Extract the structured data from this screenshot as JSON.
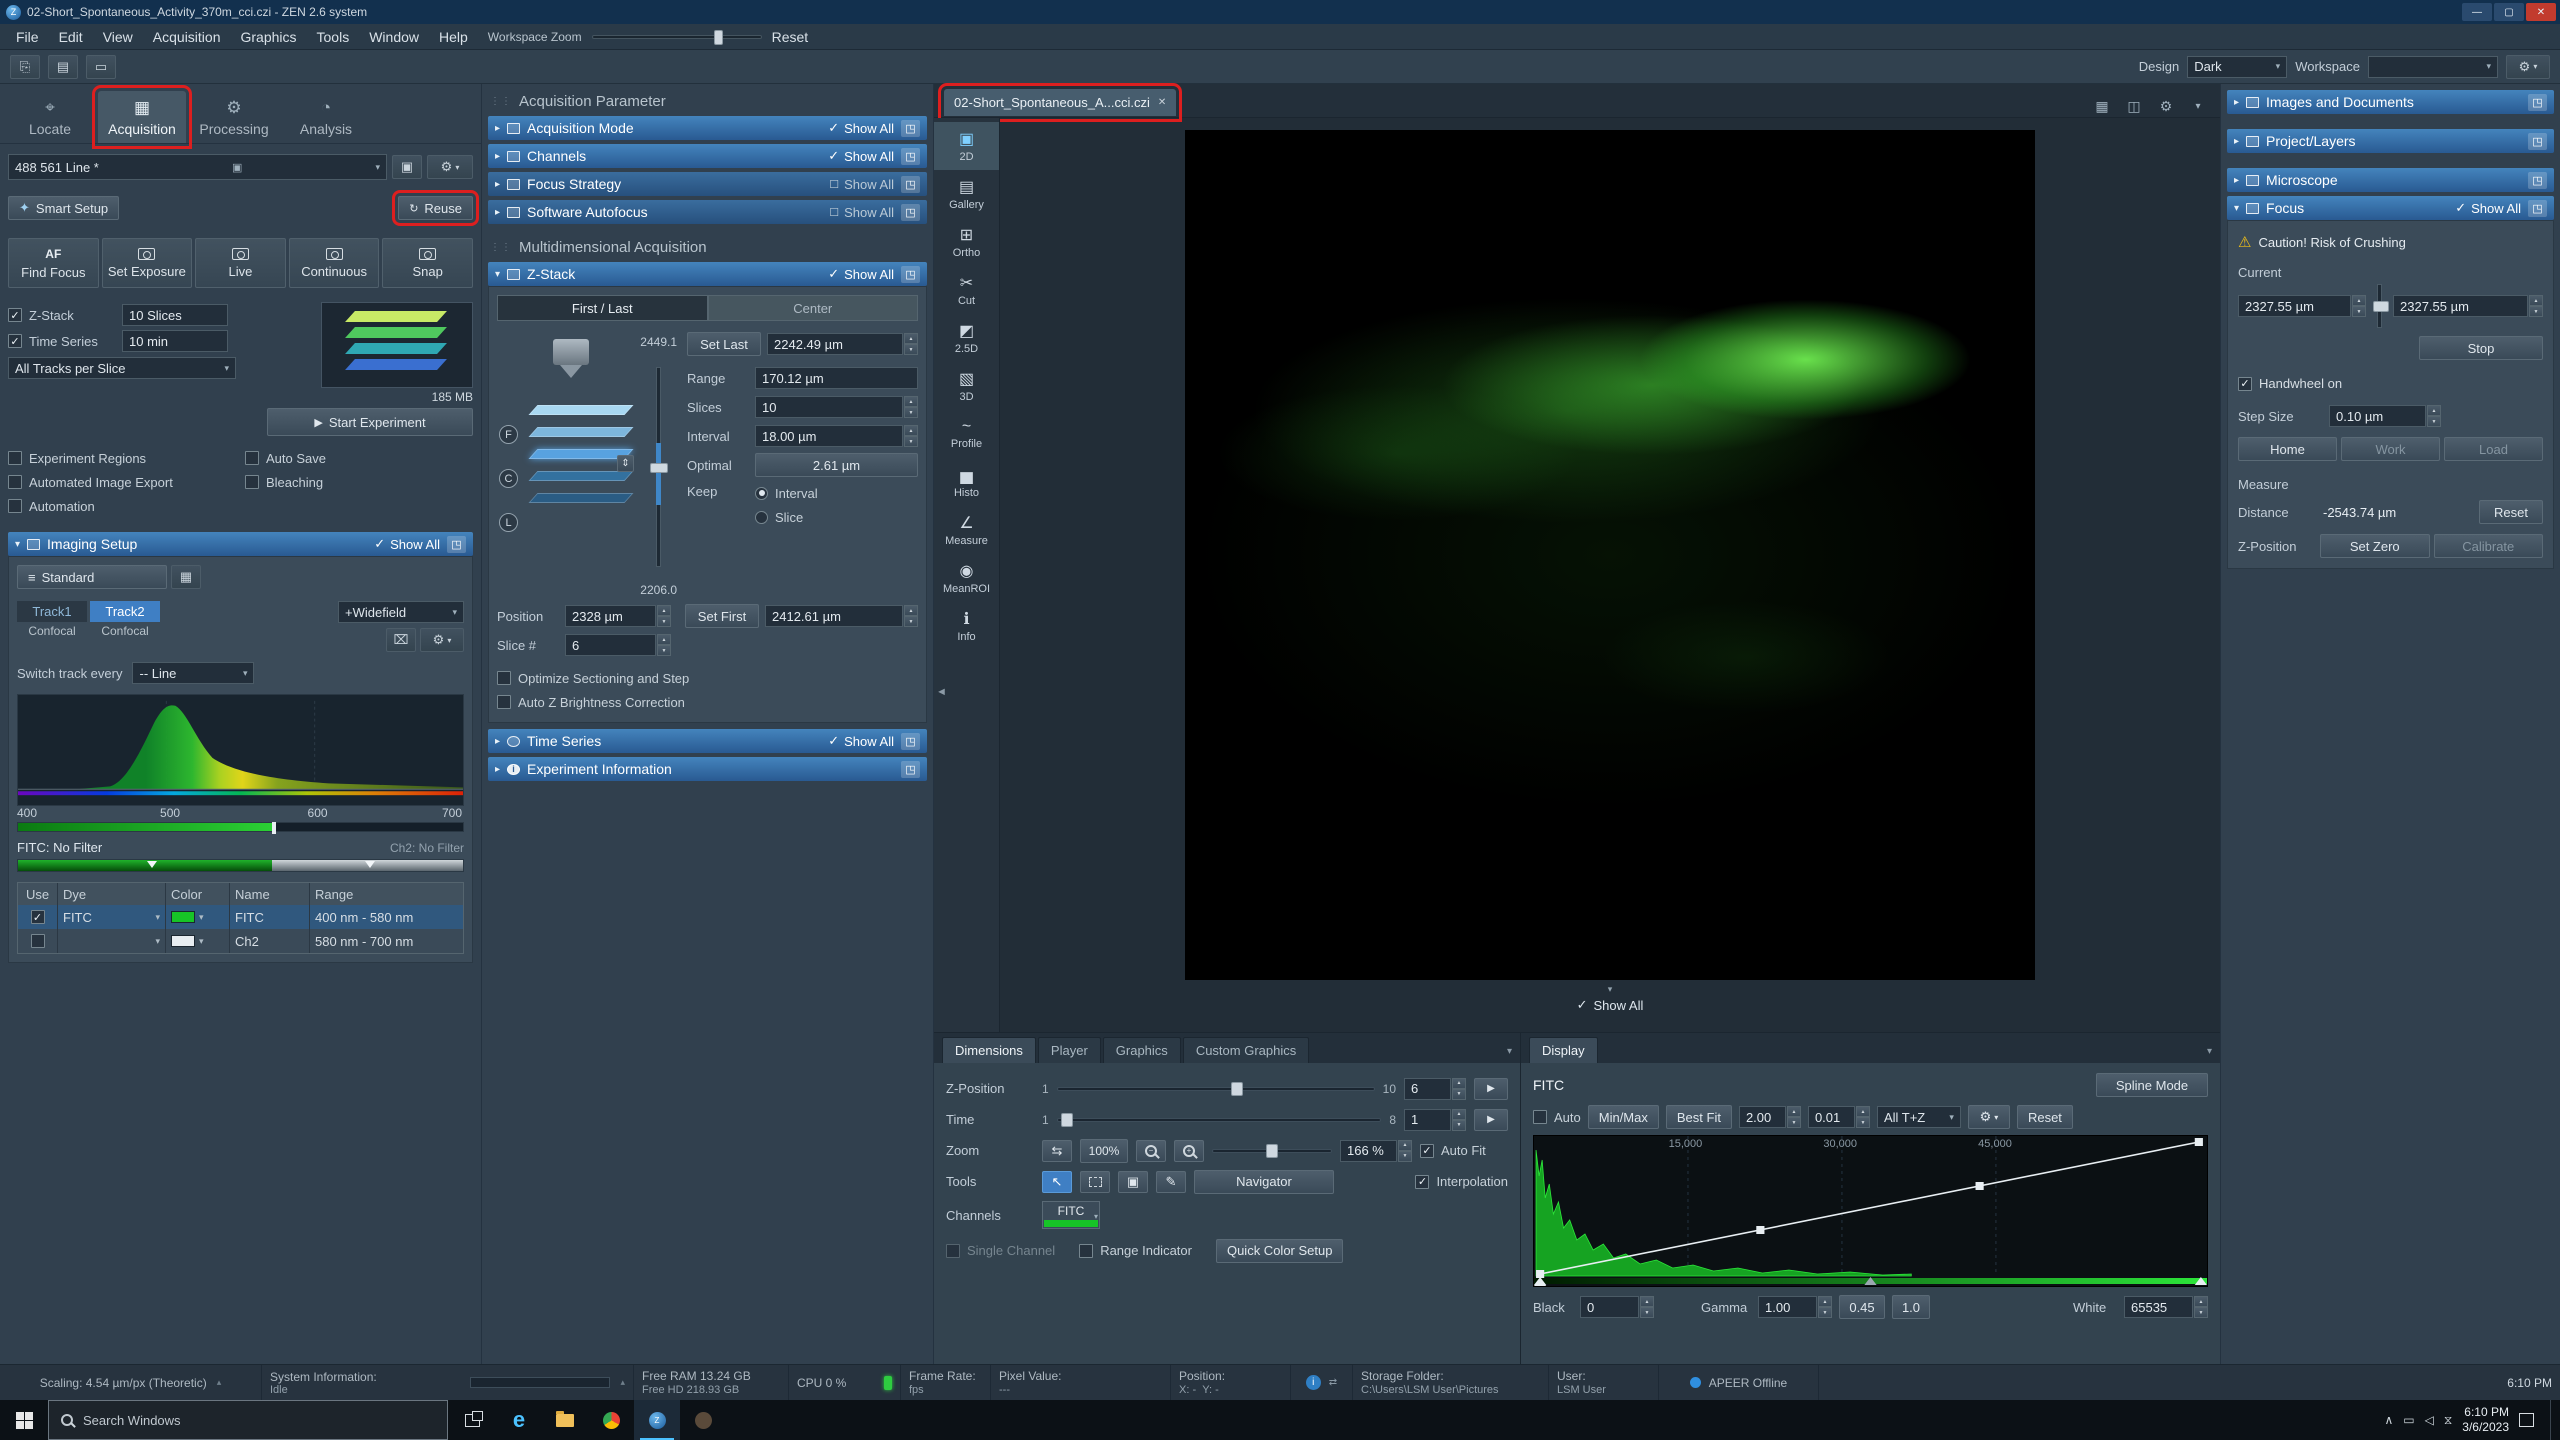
{
  "titlebar": {
    "title": "02-Short_Spontaneous_Activity_370m_cci.czi - ZEN 2.6 system"
  },
  "icons": {
    "minimize": "—",
    "maximize": "▢",
    "close": "✕",
    "collapse": "▸",
    "expand": "▾",
    "check": "✓",
    "play": "▶",
    "popout": "◳",
    "gear": "⚙",
    "warning": "⚠",
    "info": "i",
    "updown": "⇕",
    "cut": "✂",
    "cursor": "↖",
    "swap": "⇆",
    "trash": "⌧"
  },
  "menu": {
    "items": [
      "File",
      "Edit",
      "View",
      "Acquisition",
      "Graphics",
      "Tools",
      "Window",
      "Help"
    ],
    "workspace_zoom": "Workspace Zoom",
    "reset": "Reset"
  },
  "toolbar": {
    "design": "Design",
    "theme": "Dark",
    "workspace": "Workspace"
  },
  "tabs": {
    "items": [
      "Locate",
      "Acquisition",
      "Processing",
      "Analysis"
    ]
  },
  "left": {
    "config": "488 561 Line *",
    "smart_setup": "Smart Setup",
    "reuse": "Reuse",
    "af": "AF",
    "buttons": [
      "Find Focus",
      "Set Exposure",
      "Live",
      "Continuous",
      "Snap"
    ],
    "zstack_label": "Z-Stack",
    "zstack_value": "10 Slices",
    "timeseries_label": "Time Series",
    "timeseries_value": "10 min",
    "tracks_dropdown": "All Tracks per Slice",
    "memory": "185 MB",
    "start_experiment": "Start Experiment",
    "options": [
      "Experiment Regions",
      "Auto Save",
      "Automated Image Export",
      "Bleaching",
      "Automation"
    ],
    "imaging_setup": "Imaging Setup",
    "show_all": "Show All",
    "standard": "Standard",
    "track1": "Track1",
    "track2": "Track2",
    "confocal": "Confocal",
    "widefield": "+Widefield",
    "switch_track": "Switch track every",
    "switch_value": "-- Line",
    "spectrum_labels": [
      "400",
      "500",
      "600",
      "700"
    ],
    "fitc_filter": "FITC: No Filter",
    "ch2_filter": "Ch2: No Filter",
    "table": {
      "headers": [
        "Use",
        "Dye",
        "Color",
        "Name",
        "Range"
      ],
      "row1": {
        "dye": "FITC",
        "name": "FITC",
        "range": "400 nm - 580 nm"
      },
      "row2": {
        "dye": "",
        "name": "Ch2",
        "range": "580 nm - 700 nm"
      }
    }
  },
  "acq": {
    "title": "Acquisition Parameter",
    "show_all": "Show All",
    "bars": [
      "Acquisition Mode",
      "Channels",
      "Focus Strategy",
      "Software Autofocus"
    ],
    "multidim": "Multidimensional Acquisition",
    "zs": {
      "title": "Z-Stack",
      "tab_first": "First / Last",
      "tab_center": "Center",
      "top": "2449.1",
      "bottom": "2206.0",
      "set_last": "Set Last",
      "set_last_value": "2242.49 µm",
      "range_label": "Range",
      "range_value": "170.12 µm",
      "slices_label": "Slices",
      "slices_value": "10",
      "interval_label": "Interval",
      "interval_value": "18.00 µm",
      "optimal_label": "Optimal",
      "optimal_value": "2.61 µm",
      "keep_label": "Keep",
      "keep_interval": "Interval",
      "keep_slice": "Slice",
      "position_label": "Position",
      "position_value": "2328 µm",
      "set_first": "Set First",
      "set_first_value": "2412.61 µm",
      "slice_label": "Slice #",
      "slice_value": "6",
      "optimize": "Optimize Sectioning and Step",
      "auto_z": "Auto Z Brightness Correction"
    },
    "time_series": "Time Series",
    "experiment_info": "Experiment Information"
  },
  "doc": {
    "tab": "02-Short_Spontaneous_A...cci.czi",
    "tools": [
      "2D",
      "Gallery",
      "Ortho",
      "Cut",
      "2.5D",
      "3D",
      "Profile",
      "Histo",
      "Measure",
      "MeanROI",
      "Info"
    ],
    "show_all": "Show All"
  },
  "dims": {
    "tabs": [
      "Dimensions",
      "Player",
      "Graphics",
      "Custom Graphics"
    ],
    "zpos_label": "Z-Position",
    "zpos_min": "1",
    "zpos_max": "10",
    "zpos_value": "6",
    "time_label": "Time",
    "time_min": "1",
    "time_max": "8",
    "time_value": "1",
    "zoom_label": "Zoom",
    "zoom_100": "100%",
    "zoom_value": "166 %",
    "auto_fit": "Auto Fit",
    "tools_label": "Tools",
    "navigator": "Navigator",
    "interpolation": "Interpolation",
    "channels_label": "Channels",
    "channel_fitc": "FITC",
    "single_channel": "Single Channel",
    "range_indicator": "Range Indicator",
    "quick_color": "Quick Color Setup"
  },
  "display": {
    "tab": "Display",
    "channel": "FITC",
    "spline": "Spline Mode",
    "auto": "Auto",
    "minmax": "Min/Max",
    "best_fit": "Best Fit",
    "v1": "2.00",
    "v2": "0.01",
    "all_tz": "All T+Z",
    "reset": "Reset",
    "ticks": [
      "15,000",
      "30,000",
      "45,000"
    ],
    "black_label": "Black",
    "black_value": "0",
    "gamma_label": "Gamma",
    "gamma_value": "1.00",
    "g045": "0.45",
    "g10": "1.0",
    "white_label": "White",
    "white_value": "65535"
  },
  "right": {
    "bars": [
      "Images and Documents",
      "Project/Layers",
      "Microscope",
      "Focus"
    ],
    "show_all": "Show All",
    "caution": "Caution! Risk of Crushing",
    "current_label": "Current",
    "current_value1": "2327.55 µm",
    "current_value2": "2327.55 µm",
    "stop": "Stop",
    "handwheel": "Handwheel on",
    "step_label": "Step Size",
    "step_value": "0.10 µm",
    "home": "Home",
    "work": "Work",
    "load": "Load",
    "measure": "Measure",
    "distance_label": "Distance",
    "distance_value": "-2543.74 µm",
    "reset": "Reset",
    "zpos_label": "Z-Position",
    "set_zero": "Set Zero",
    "calibrate": "Calibrate"
  },
  "status": {
    "scaling": "Scaling:  4.54 µm/px (Theoretic)",
    "sysinfo_label": "System Information:",
    "sysinfo_value": "Idle",
    "ram": "Free RAM 13.24 GB",
    "hd": "Free HD   218.93 GB",
    "cpu": "CPU 0 %",
    "frame_label": "Frame Rate:",
    "frame_value": "fps",
    "pixel_label": "Pixel Value:",
    "pixel_value": "---",
    "pos_label": "Position:",
    "pos_x": "X: -",
    "pos_y": "Y: -",
    "storage_label": "Storage Folder:",
    "storage_value": "C:\\Users\\LSM User\\Pictures",
    "user_label": "User:",
    "user_value": "LSM User",
    "apeer": "APEER Offline",
    "time": "6:10 PM"
  },
  "taskbar": {
    "search": "Search Windows",
    "time": "6:10 PM",
    "date": "3/6/2023"
  }
}
